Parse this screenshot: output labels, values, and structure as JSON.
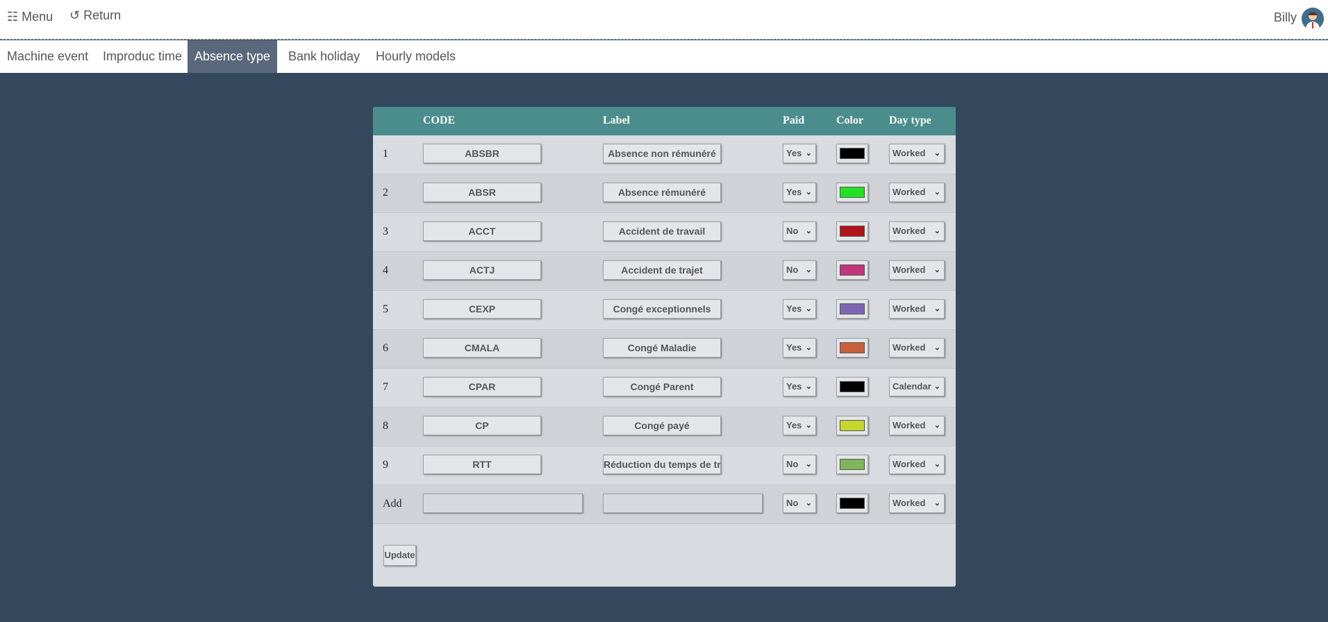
{
  "topbar": {
    "menu_label": "☷ Menu",
    "return_label": "↺ Return",
    "user_name": "Billy"
  },
  "tabs": [
    {
      "label": "Machine event"
    },
    {
      "label": "Improduc time"
    },
    {
      "label": "Absence type",
      "active": true
    },
    {
      "label": "Bank holiday"
    },
    {
      "label": "Hourly models"
    }
  ],
  "table": {
    "headers": {
      "code": "CODE",
      "label": "Label",
      "paid": "Paid",
      "color": "Color",
      "day_type": "Day type"
    },
    "rows": [
      {
        "num": "1",
        "code": "ABSBR",
        "label": "Absence non rémunéré",
        "paid": "Yes",
        "color": "#000000",
        "day_type": "Worked"
      },
      {
        "num": "2",
        "code": "ABSR",
        "label": "Absence rémunéré",
        "paid": "Yes",
        "color": "#22e022",
        "day_type": "Worked"
      },
      {
        "num": "3",
        "code": "ACCT",
        "label": "Accident de travail",
        "paid": "No",
        "color": "#b0141a",
        "day_type": "Worked"
      },
      {
        "num": "4",
        "code": "ACTJ",
        "label": "Accident de trajet",
        "paid": "No",
        "color": "#c2357a",
        "day_type": "Worked"
      },
      {
        "num": "5",
        "code": "CEXP",
        "label": "Congé exceptionnels",
        "paid": "Yes",
        "color": "#7c66b3",
        "day_type": "Worked"
      },
      {
        "num": "6",
        "code": "CMALA",
        "label": "Congé Maladie",
        "paid": "Yes",
        "color": "#c8603a",
        "day_type": "Worked"
      },
      {
        "num": "7",
        "code": "CPAR",
        "label": "Congé Parent",
        "paid": "Yes",
        "color": "#000000",
        "day_type": "Calendar"
      },
      {
        "num": "8",
        "code": "CP",
        "label": "Congé payé",
        "paid": "Yes",
        "color": "#c4d82c",
        "day_type": "Worked"
      },
      {
        "num": "9",
        "code": "RTT",
        "label": "Réduction du temps de trav",
        "paid": "No",
        "color": "#7fb55a",
        "day_type": "Worked"
      }
    ],
    "add_row": {
      "label": "Add",
      "paid": "No",
      "color": "#000000",
      "day_type": "Worked"
    },
    "update_label": "Update"
  }
}
